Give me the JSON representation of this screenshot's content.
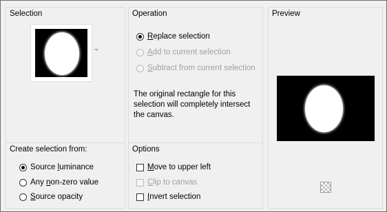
{
  "selection": {
    "title": "Selection"
  },
  "operation": {
    "title": "Operation",
    "options": [
      {
        "label": "Replace selection",
        "underline": "R",
        "rest": "eplace selection",
        "checked": true,
        "disabled": false
      },
      {
        "label": "Add to current selection",
        "underline": "A",
        "rest": "dd to current selection",
        "checked": false,
        "disabled": true
      },
      {
        "label": "Subtract from current selection",
        "underline": "S",
        "rest": "ubtract from current selection",
        "checked": false,
        "disabled": true
      }
    ],
    "description": "The original rectangle for this selection will completely intersect the canvas."
  },
  "preview": {
    "title": "Preview"
  },
  "create_from": {
    "title": "Create selection from:",
    "options": [
      {
        "pre": "Source ",
        "underline": "l",
        "rest": "uminance",
        "checked": true
      },
      {
        "pre": "Any ",
        "underline": "n",
        "rest": "on-zero value",
        "checked": false
      },
      {
        "pre": "",
        "underline": "S",
        "rest": "ource opacity",
        "checked": false
      }
    ]
  },
  "options": {
    "title": "Options",
    "items": [
      {
        "underline": "M",
        "rest": "ove to upper left",
        "checked": false,
        "disabled": false
      },
      {
        "underline": "C",
        "rest": "lip to canvas",
        "checked": false,
        "disabled": true
      },
      {
        "underline": "I",
        "rest": "nvert selection",
        "checked": false,
        "disabled": false
      }
    ]
  },
  "icons": {
    "selection_dropdown": "chevron-down-icon",
    "transparency_toggle": "checkerboard-icon"
  }
}
